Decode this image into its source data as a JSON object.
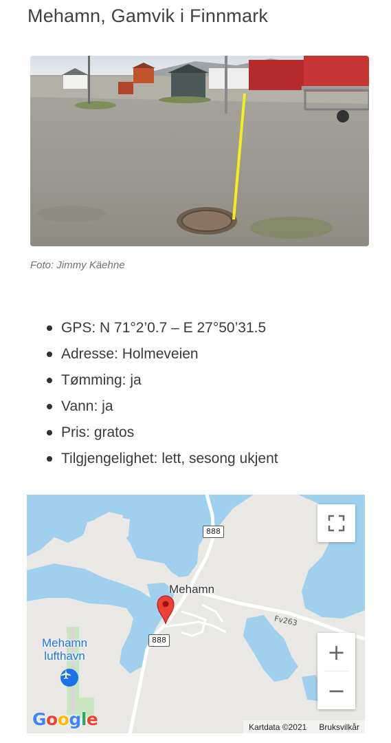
{
  "page": {
    "title": "Mehamn, Gamvik i Finnmark",
    "photo_caption": "Foto: Jimmy Käehne"
  },
  "facts": [
    {
      "text": "GPS: N 71°2’0.7 – E 27°50’31.5"
    },
    {
      "text": "Adresse: Holmeveien"
    },
    {
      "text": "Tømming: ja"
    },
    {
      "text": "Vann: ja"
    },
    {
      "text": "Pris: gratos"
    },
    {
      "text": "Tilgjengelighet: lett, sesong ukjent"
    }
  ],
  "map": {
    "place_label": "Mehamn",
    "airport_label_line1": "Mehamn",
    "airport_label_line2": "lufthavn",
    "road_888_top": "888",
    "road_888_bottom": "888",
    "road_fv263": "Fv263",
    "zoom_in": "+",
    "zoom_out": "−",
    "attribution": "Kartdata ©2021",
    "terms": "Bruksvilkår",
    "icons": [
      "fullscreen-icon",
      "map-pin-icon",
      "airplane-icon",
      "google-logo"
    ],
    "colors": {
      "water": "#9fd0ee",
      "land": "#e9e8e5",
      "pin": "#ea4335",
      "airport": "#1a73e8",
      "green": "#c8e6c0"
    }
  }
}
